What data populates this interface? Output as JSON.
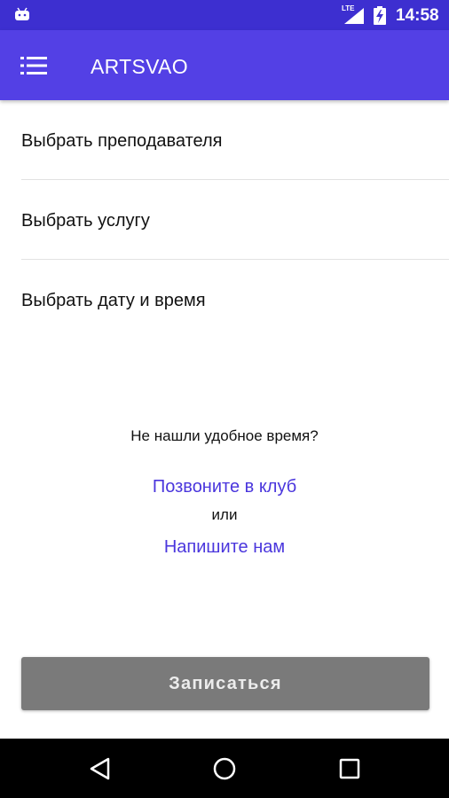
{
  "status_bar": {
    "network_label": "LTE",
    "time": "14:58",
    "icons": [
      "android-icon",
      "signal-icon",
      "battery-charging-icon"
    ]
  },
  "app_bar": {
    "title": "ARTSVAO",
    "menu_icon": "menu-list-icon"
  },
  "selection": {
    "items": [
      {
        "label": "Выбрать преподавателя"
      },
      {
        "label": "Выбрать услугу"
      },
      {
        "label": "Выбрать дату и время"
      }
    ]
  },
  "contact": {
    "question": "Не нашли удобное время?",
    "call_link": "Позвоните в клуб",
    "or_text": "или",
    "write_link": "Напишите нам"
  },
  "submit": {
    "label": "Записаться"
  },
  "nav_bar": {
    "icons": [
      "back-icon",
      "home-icon",
      "recents-icon"
    ]
  },
  "colors": {
    "status_bar": "#3d2fd0",
    "app_bar": "#5340e5",
    "link": "#4a36dd",
    "button": "#7a7a7a",
    "nav_bar": "#000000"
  }
}
